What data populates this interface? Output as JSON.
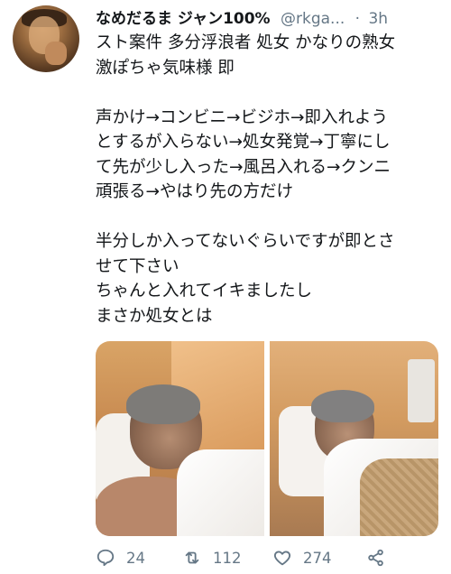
{
  "tweet": {
    "display_name": "なめだるま ジャン100%",
    "handle": "@rkga...",
    "separator": "·",
    "timestamp": "3h",
    "lines": [
      "スト案件 多分浮浪者 処女 かなりの熟女",
      "激ぽちゃ気味様 即",
      "",
      "声かけ→コンビニ→ビジホ→即入れよう",
      "とするが入らない→処女発覚→丁寧にし",
      "て先が少し入った→風呂入れる→クンニ",
      "頑張る→やはり先の方だけ",
      "",
      "半分しか入ってないぐらいですが即とさ",
      "せて下さい",
      "ちゃんと入れてイキましたし",
      "まさか処女とは"
    ]
  },
  "actions": {
    "reply_count": "24",
    "retweet_count": "112",
    "like_count": "274"
  },
  "icons": {
    "reply": "reply-icon",
    "retweet": "retweet-icon",
    "like": "heart-icon",
    "share": "share-icon"
  },
  "colors": {
    "text": "#14171a",
    "secondary": "#657786"
  }
}
